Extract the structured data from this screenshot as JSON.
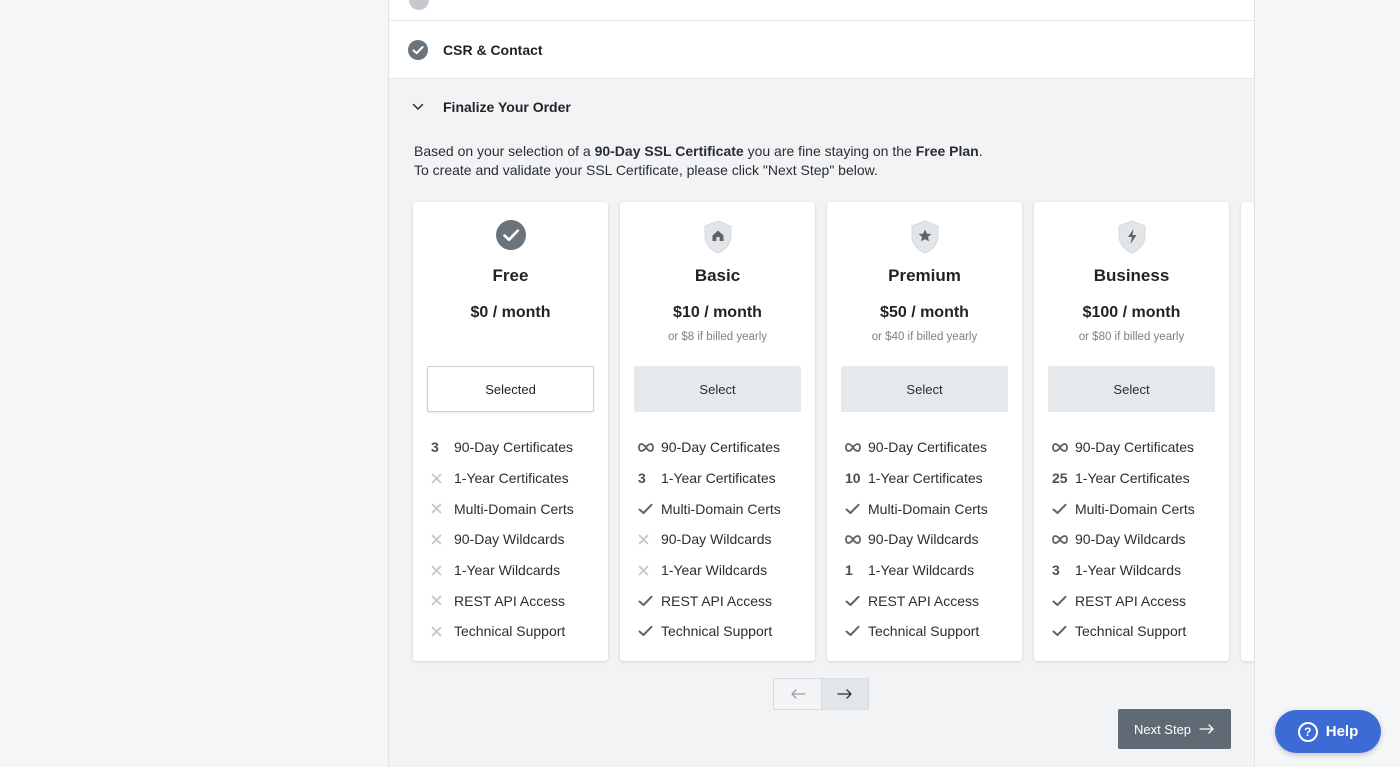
{
  "steps": {
    "csr_label": "CSR & Contact",
    "finalize_label": "Finalize Your Order"
  },
  "intro": {
    "line1_pre": "Based on your selection of a ",
    "line1_bold1": "90-Day SSL Certificate",
    "line1_mid": " you are fine staying on the ",
    "line1_bold2": "Free Plan",
    "line1_end": ".",
    "line2": "To create and validate your SSL Certificate, please click \"Next Step\" below."
  },
  "feature_labels": [
    "90-Day Certificates",
    "1-Year Certificates",
    "Multi-Domain Certs",
    "90-Day Wildcards",
    "1-Year Wildcards",
    "REST API Access",
    "Technical Support"
  ],
  "plans": [
    {
      "name": "Free",
      "icon": "check-circle-icon",
      "price": "$0 / month",
      "yearly": "",
      "button": "Selected",
      "selected": true,
      "features": [
        "3",
        "x",
        "x",
        "x",
        "x",
        "x",
        "x"
      ]
    },
    {
      "name": "Basic",
      "icon": "shield-home-icon",
      "price": "$10 / month",
      "yearly": "or $8 if billed yearly",
      "button": "Select",
      "selected": false,
      "features": [
        "∞",
        "3",
        "check",
        "x",
        "x",
        "check",
        "check"
      ]
    },
    {
      "name": "Premium",
      "icon": "shield-star-icon",
      "price": "$50 / month",
      "yearly": "or $40 if billed yearly",
      "button": "Select",
      "selected": false,
      "features": [
        "∞",
        "10",
        "check",
        "∞",
        "1",
        "check",
        "check"
      ]
    },
    {
      "name": "Business",
      "icon": "shield-bolt-icon",
      "price": "$100 / month",
      "yearly": "or $80 if billed yearly",
      "button": "Select",
      "selected": false,
      "features": [
        "∞",
        "25",
        "check",
        "∞",
        "3",
        "check",
        "check"
      ]
    }
  ],
  "actions": {
    "next_step_label": "Next Step",
    "help_label": "Help"
  },
  "colors": {
    "help_bg": "#3d6bd6",
    "next_step_bg": "#5f6a75",
    "panel_bg": "#f2f3f5"
  }
}
